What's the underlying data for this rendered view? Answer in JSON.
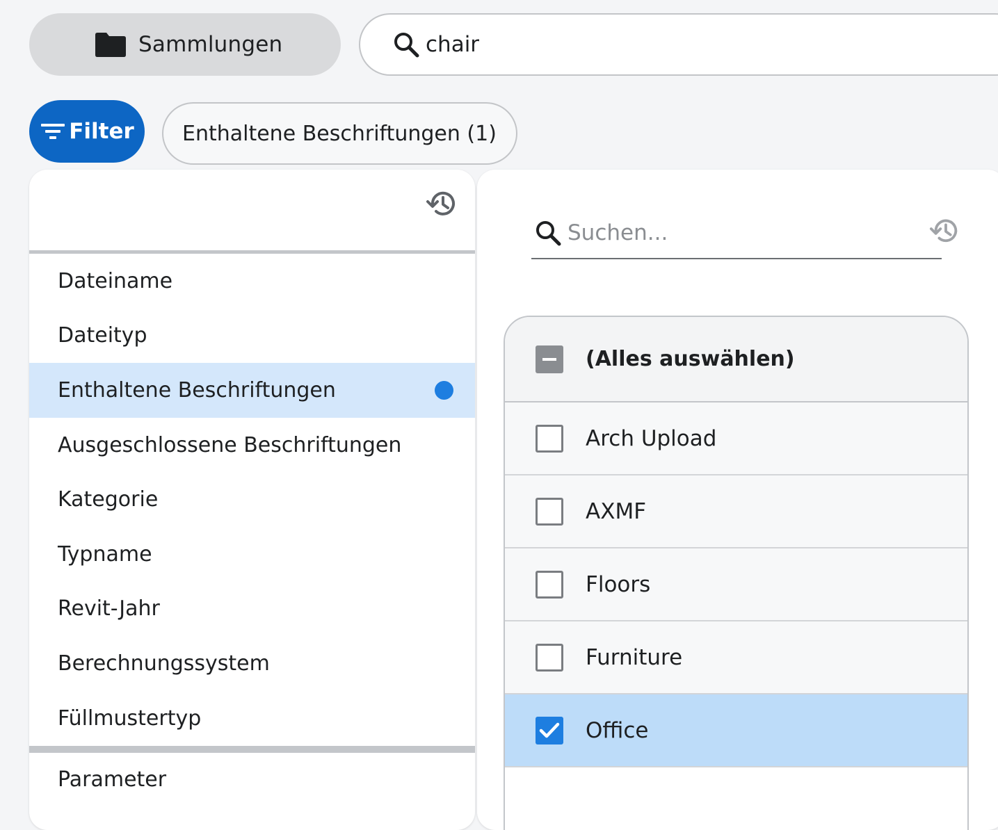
{
  "top": {
    "collections_label": "Sammlungen",
    "search_value": "chair"
  },
  "filter": {
    "button_label": "Filter",
    "chip_label": "Enthaltene Beschriftungen (1)"
  },
  "left_panel": {
    "items": [
      {
        "label": "Dateiname"
      },
      {
        "label": "Dateityp"
      },
      {
        "label": "Enthaltene Beschriftungen",
        "active": true
      },
      {
        "label": "Ausgeschlossene Beschriftungen"
      },
      {
        "label": "Kategorie"
      },
      {
        "label": "Typname"
      },
      {
        "label": "Revit-Jahr"
      },
      {
        "label": "Berechnungssystem"
      },
      {
        "label": "Füllmustertyp"
      }
    ],
    "footer_item": "Parameter"
  },
  "right_panel": {
    "search_placeholder": "Suchen...",
    "select_all_label": "(Alles auswählen)",
    "options": [
      {
        "label": "Arch Upload",
        "checked": false
      },
      {
        "label": "AXMF",
        "checked": false
      },
      {
        "label": "Floors",
        "checked": false
      },
      {
        "label": "Furniture",
        "checked": false
      },
      {
        "label": "Office",
        "checked": true
      }
    ]
  },
  "colors": {
    "primary": "#0d66c4",
    "active_item_bg": "#d4e7fb",
    "selected_row_bg": "#bddcf9",
    "indicator_dot": "#1e7ee0"
  }
}
